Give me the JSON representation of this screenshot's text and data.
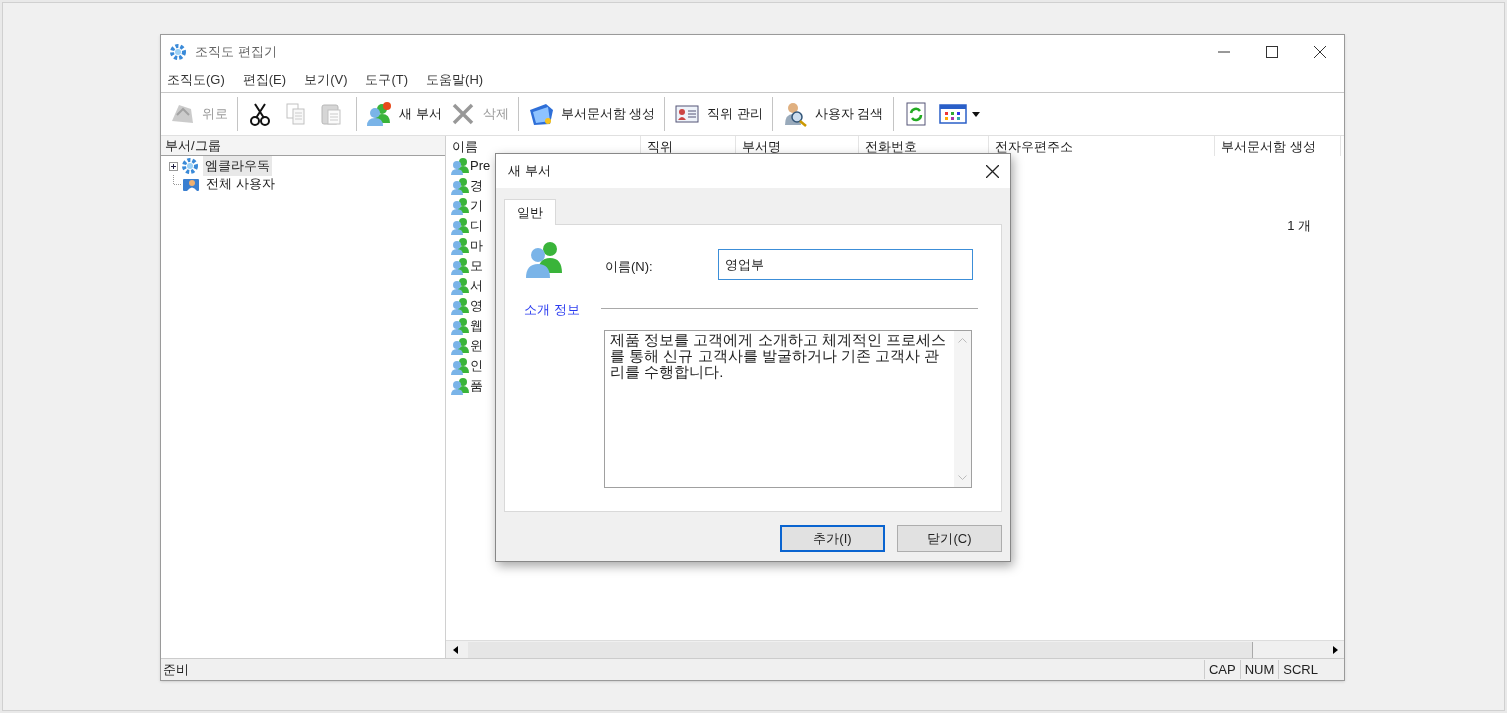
{
  "window": {
    "title": "조직도 편집기"
  },
  "menu": [
    "조직도(G)",
    "편집(E)",
    "보기(V)",
    "도구(T)",
    "도움말(H)"
  ],
  "toolbar": [
    {
      "kind": "button",
      "label": "위로",
      "disabled": true
    },
    {
      "kind": "separator"
    },
    {
      "kind": "button",
      "disabled": false
    },
    {
      "kind": "button",
      "disabled": true
    },
    {
      "kind": "button",
      "disabled": true
    },
    {
      "kind": "separator"
    },
    {
      "kind": "button",
      "label": "새 부서",
      "disabled": false
    },
    {
      "kind": "button",
      "label": "삭제",
      "disabled": true
    },
    {
      "kind": "separator"
    },
    {
      "kind": "button",
      "label": "부서문서함 생성",
      "disabled": false
    },
    {
      "kind": "separator"
    },
    {
      "kind": "button",
      "label": "직위 관리",
      "disabled": false
    },
    {
      "kind": "separator"
    },
    {
      "kind": "button",
      "label": "사용자 검색",
      "disabled": false
    },
    {
      "kind": "separator"
    },
    {
      "kind": "button",
      "disabled": false
    },
    {
      "kind": "dropdown",
      "disabled": false
    }
  ],
  "tree": {
    "header": "부서/그룹",
    "items": [
      {
        "label": "엠클라우독",
        "selected": true,
        "expanded": false
      },
      {
        "label": "전체 사용자",
        "selected": false
      }
    ]
  },
  "table": {
    "columns": [
      "이름",
      "직위",
      "부서명",
      "전화번호",
      "전자우편주소",
      "부서문서함 생성"
    ],
    "rows": [
      {
        "name": "Pre"
      },
      {
        "name": "경"
      },
      {
        "name": "기"
      },
      {
        "name": "디",
        "doc_box": "1 개"
      },
      {
        "name": "마"
      },
      {
        "name": "모"
      },
      {
        "name": "서"
      },
      {
        "name": "영"
      },
      {
        "name": "웹"
      },
      {
        "name": "윈"
      },
      {
        "name": "인"
      },
      {
        "name": "품"
      }
    ]
  },
  "status_bar": {
    "text": "준비",
    "indicators": [
      "CAP",
      "NUM",
      "SCRL"
    ]
  },
  "dialog": {
    "title": "새 부서",
    "tabs": [
      {
        "label": "일반",
        "selected": true
      }
    ],
    "name_label": "이름(N):",
    "name_value": "영업부",
    "section": "소개 정보",
    "description": "제품 정보를 고객에게 소개하고 체계적인 프로세스를 통해 신규 고객사를 발굴하거나 기존 고객사 관리를 수행합니다.",
    "buttons": [
      {
        "label": "추가(I)",
        "default": true
      },
      {
        "label": "닫기(C)",
        "default": false
      }
    ]
  }
}
